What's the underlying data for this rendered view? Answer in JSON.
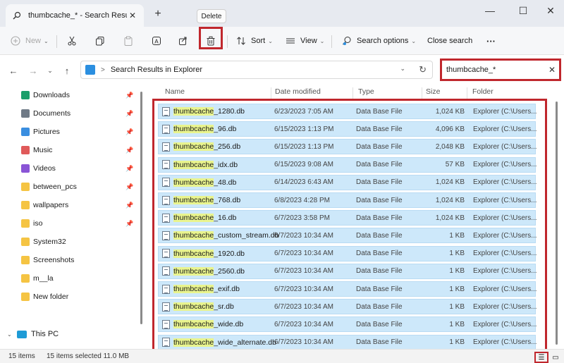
{
  "window": {
    "tab_title": "thumbcache_* - Search Result",
    "tab_close": "✕",
    "new_tab": "+",
    "minimize": "—",
    "maximize": "☐",
    "close": "✕"
  },
  "tooltip": {
    "text": "Delete"
  },
  "toolbar": {
    "new_label": "New",
    "sort_label": "Sort",
    "view_label": "View",
    "search_options_label": "Search options",
    "close_search_label": "Close search",
    "more_label": "···"
  },
  "address": {
    "path": "Search Results in Explorer",
    "separator": ">"
  },
  "search": {
    "value": "thumbcache_*",
    "clear": "✕"
  },
  "sidebar": {
    "items": [
      {
        "label": "Downloads",
        "icon": "download-icon",
        "color": "#1a9e6a",
        "pinned": true
      },
      {
        "label": "Documents",
        "icon": "document-icon",
        "color": "#6f7a86",
        "pinned": true
      },
      {
        "label": "Pictures",
        "icon": "picture-icon",
        "color": "#3a8ee0",
        "pinned": true
      },
      {
        "label": "Music",
        "icon": "music-icon",
        "color": "#e05a5a",
        "pinned": true
      },
      {
        "label": "Videos",
        "icon": "video-icon",
        "color": "#8a55d6",
        "pinned": true
      },
      {
        "label": "between_pcs",
        "icon": "folder-icon",
        "color": "#f5c443",
        "pinned": true
      },
      {
        "label": "wallpapers",
        "icon": "folder-icon",
        "color": "#f5c443",
        "pinned": true
      },
      {
        "label": "iso",
        "icon": "folder-icon",
        "color": "#f5c443",
        "pinned": true
      },
      {
        "label": "System32",
        "icon": "folder-icon",
        "color": "#f5c443",
        "pinned": false
      },
      {
        "label": "Screenshots",
        "icon": "folder-icon",
        "color": "#f5c443",
        "pinned": false
      },
      {
        "label": "m__la",
        "icon": "folder-icon",
        "color": "#f5c443",
        "pinned": false
      },
      {
        "label": "New folder",
        "icon": "folder-icon",
        "color": "#f5c443",
        "pinned": false
      }
    ],
    "this_pc": "This PC"
  },
  "columns": {
    "name": "Name",
    "date": "Date modified",
    "type": "Type",
    "size": "Size",
    "folder": "Folder"
  },
  "files": [
    {
      "prefix": "thumbcache",
      "rest": "_1280.db",
      "date": "6/23/2023 7:05 AM",
      "type": "Data Base File",
      "size": "1,024 KB",
      "folder": "Explorer (C:\\Users..."
    },
    {
      "prefix": "thumbcache",
      "rest": "_96.db",
      "date": "6/15/2023 1:13 PM",
      "type": "Data Base File",
      "size": "4,096 KB",
      "folder": "Explorer (C:\\Users..."
    },
    {
      "prefix": "thumbcache",
      "rest": "_256.db",
      "date": "6/15/2023 1:13 PM",
      "type": "Data Base File",
      "size": "2,048 KB",
      "folder": "Explorer (C:\\Users..."
    },
    {
      "prefix": "thumbcache",
      "rest": "_idx.db",
      "date": "6/15/2023 9:08 AM",
      "type": "Data Base File",
      "size": "57 KB",
      "folder": "Explorer (C:\\Users..."
    },
    {
      "prefix": "thumbcache",
      "rest": "_48.db",
      "date": "6/14/2023 6:43 AM",
      "type": "Data Base File",
      "size": "1,024 KB",
      "folder": "Explorer (C:\\Users..."
    },
    {
      "prefix": "thumbcache",
      "rest": "_768.db",
      "date": "6/8/2023 4:28 PM",
      "type": "Data Base File",
      "size": "1,024 KB",
      "folder": "Explorer (C:\\Users..."
    },
    {
      "prefix": "thumbcache",
      "rest": "_16.db",
      "date": "6/7/2023 3:58 PM",
      "type": "Data Base File",
      "size": "1,024 KB",
      "folder": "Explorer (C:\\Users..."
    },
    {
      "prefix": "thumbcache",
      "rest": "_custom_stream.db",
      "date": "6/7/2023 10:34 AM",
      "type": "Data Base File",
      "size": "1 KB",
      "folder": "Explorer (C:\\Users..."
    },
    {
      "prefix": "thumbcache",
      "rest": "_1920.db",
      "date": "6/7/2023 10:34 AM",
      "type": "Data Base File",
      "size": "1 KB",
      "folder": "Explorer (C:\\Users..."
    },
    {
      "prefix": "thumbcache",
      "rest": "_2560.db",
      "date": "6/7/2023 10:34 AM",
      "type": "Data Base File",
      "size": "1 KB",
      "folder": "Explorer (C:\\Users..."
    },
    {
      "prefix": "thumbcache",
      "rest": "_exif.db",
      "date": "6/7/2023 10:34 AM",
      "type": "Data Base File",
      "size": "1 KB",
      "folder": "Explorer (C:\\Users..."
    },
    {
      "prefix": "thumbcache",
      "rest": "_sr.db",
      "date": "6/7/2023 10:34 AM",
      "type": "Data Base File",
      "size": "1 KB",
      "folder": "Explorer (C:\\Users..."
    },
    {
      "prefix": "thumbcache",
      "rest": "_wide.db",
      "date": "6/7/2023 10:34 AM",
      "type": "Data Base File",
      "size": "1 KB",
      "folder": "Explorer (C:\\Users..."
    },
    {
      "prefix": "thumbcache",
      "rest": "_wide_alternate.db",
      "date": "6/7/2023 10:34 AM",
      "type": "Data Base File",
      "size": "1 KB",
      "folder": "Explorer (C:\\Users..."
    }
  ],
  "status": {
    "items": "15 items",
    "selected": "15 items selected  11.0 MB"
  }
}
